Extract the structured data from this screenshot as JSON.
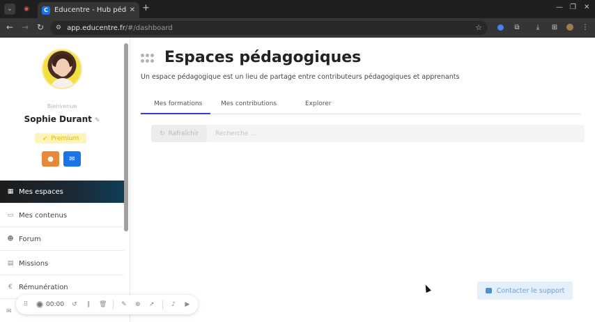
{
  "browser": {
    "tab_title": "Educentre - Hub pédag...",
    "tab_favicon_letter": "C",
    "url_host": "app.educentre.fr",
    "url_path": "/#/dashboard"
  },
  "sidebar": {
    "welcome": "Bienvenue",
    "user_name": "Sophie Durant",
    "badge": "Premium",
    "items": [
      {
        "label": "Mes espaces"
      },
      {
        "label": "Mes contenus"
      },
      {
        "label": "Forum"
      },
      {
        "label": "Missions"
      },
      {
        "label": "Rémunération"
      }
    ]
  },
  "main": {
    "title": "Espaces pédagogiques",
    "subtitle": "Un espace pédagogique est un lieu de partage entre contributeurs pédagogiques et apprenants",
    "tabs": [
      {
        "label": "Mes formations"
      },
      {
        "label": "Mes contributions"
      },
      {
        "label": "Explorer"
      }
    ],
    "refresh_label": "Rafraîchir",
    "search_placeholder": "Recherche ...",
    "support_label": "Contacter le support"
  },
  "recorder": {
    "time": "00:00"
  },
  "colors": {
    "accent": "#3b3bd4",
    "active_nav": "#0f3d58",
    "profile_button": "#e8893a",
    "mail_button": "#1a73e8",
    "premium_bg": "#fdf4b8"
  }
}
